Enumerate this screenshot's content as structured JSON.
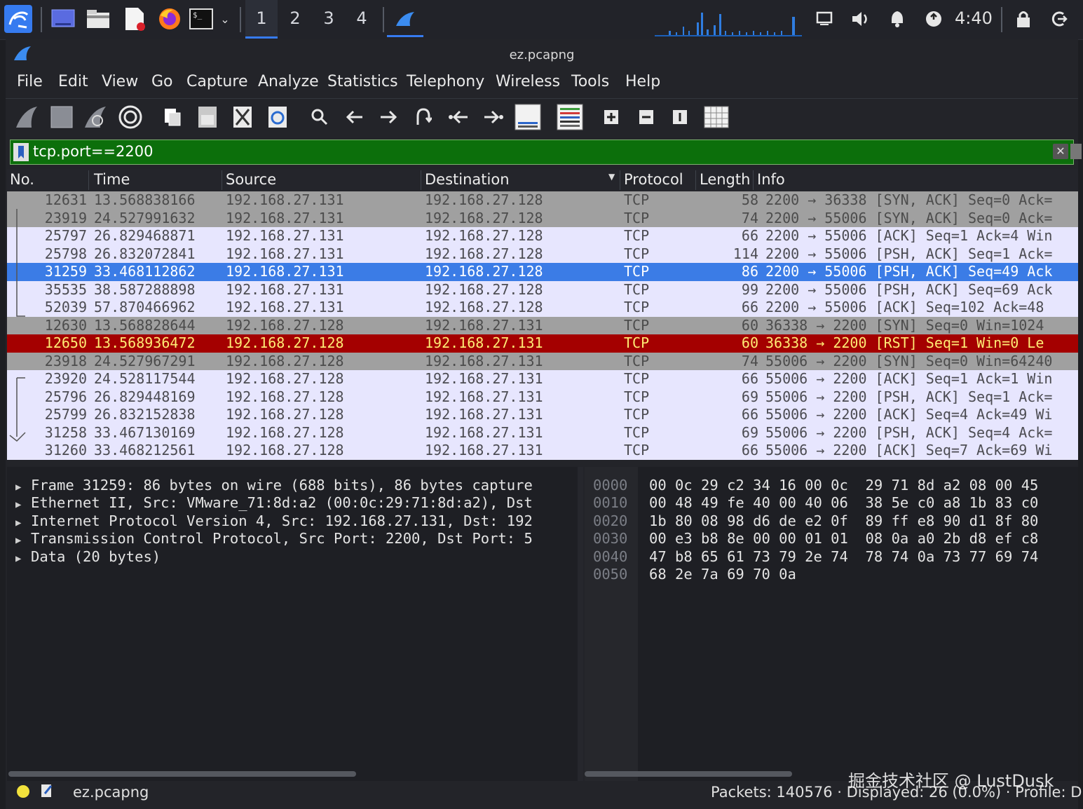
{
  "taskbar": {
    "workspaces": [
      "1",
      "2",
      "3",
      "4"
    ],
    "active_workspace": "1",
    "clock": "4:40",
    "icons": [
      "kali-menu-icon",
      "desktop-icon",
      "file-manager-icon",
      "text-editor-icon",
      "firefox-icon",
      "terminal-icon",
      "chevron-down-icon",
      "wireshark-taskbar-icon",
      "network-graph",
      "screen-icon",
      "volume-icon",
      "bell-icon",
      "power-icon",
      "lock-icon",
      "logout-icon"
    ]
  },
  "window": {
    "title": "ez.pcapng"
  },
  "menu": [
    "File",
    "Edit",
    "View",
    "Go",
    "Capture",
    "Analyze",
    "Statistics",
    "Telephony",
    "Wireless",
    "Tools",
    "Help"
  ],
  "toolbar": [
    "start-capture-icon",
    "stop-capture-icon",
    "restart-capture-icon",
    "capture-options-icon",
    "open-icon",
    "save-icon",
    "close-file-icon",
    "reload-icon",
    "find-icon",
    "back-icon",
    "forward-icon",
    "goto-packet-icon",
    "first-packet-icon",
    "last-packet-icon",
    "autoscroll-icon",
    "colorize-icon",
    "zoom-in-icon",
    "zoom-out-icon",
    "normal-size-icon",
    "resize-columns-icon"
  ],
  "filter": {
    "value": "tcp.port==2200"
  },
  "columns": [
    "No.",
    "Time",
    "Source",
    "Destination",
    "Protocol",
    "Length",
    "Info"
  ],
  "packets": [
    {
      "no": "12631",
      "time": "13.568838166",
      "src": "192.168.27.131",
      "dst": "192.168.27.128",
      "proto": "TCP",
      "len": "58",
      "info": "2200 → 36338 [SYN, ACK] Seq=0 Ack=",
      "style": "gray"
    },
    {
      "no": "23919",
      "time": "24.527991632",
      "src": "192.168.27.131",
      "dst": "192.168.27.128",
      "proto": "TCP",
      "len": "74",
      "info": "2200 → 55006 [SYN, ACK] Seq=0 Ack=",
      "style": "gray"
    },
    {
      "no": "25797",
      "time": "26.829468871",
      "src": "192.168.27.131",
      "dst": "192.168.27.128",
      "proto": "TCP",
      "len": "66",
      "info": "2200 → 55006 [ACK] Seq=1 Ack=4 Win",
      "style": "light"
    },
    {
      "no": "25798",
      "time": "26.832072841",
      "src": "192.168.27.131",
      "dst": "192.168.27.128",
      "proto": "TCP",
      "len": "114",
      "info": "2200 → 55006 [PSH, ACK] Seq=1 Ack=",
      "style": "light"
    },
    {
      "no": "31259",
      "time": "33.468112862",
      "src": "192.168.27.131",
      "dst": "192.168.27.128",
      "proto": "TCP",
      "len": "86",
      "info": "2200 → 55006 [PSH, ACK] Seq=49 Ack",
      "style": "sel"
    },
    {
      "no": "35535",
      "time": "38.587288898",
      "src": "192.168.27.131",
      "dst": "192.168.27.128",
      "proto": "TCP",
      "len": "99",
      "info": "2200 → 55006 [PSH, ACK] Seq=69 Ack",
      "style": "light"
    },
    {
      "no": "52039",
      "time": "57.870466962",
      "src": "192.168.27.131",
      "dst": "192.168.27.128",
      "proto": "TCP",
      "len": "66",
      "info": "2200 → 55006 [ACK] Seq=102 Ack=48",
      "style": "light"
    },
    {
      "no": "12630",
      "time": "13.568828644",
      "src": "192.168.27.128",
      "dst": "192.168.27.131",
      "proto": "TCP",
      "len": "60",
      "info": "36338 → 2200 [SYN] Seq=0 Win=1024",
      "style": "gray"
    },
    {
      "no": "12650",
      "time": "13.568936472",
      "src": "192.168.27.128",
      "dst": "192.168.27.131",
      "proto": "TCP",
      "len": "60",
      "info": "36338 → 2200 [RST] Seq=1 Win=0 Le",
      "style": "red"
    },
    {
      "no": "23918",
      "time": "24.527967291",
      "src": "192.168.27.128",
      "dst": "192.168.27.131",
      "proto": "TCP",
      "len": "74",
      "info": "55006 → 2200 [SYN] Seq=0 Win=64240",
      "style": "gray"
    },
    {
      "no": "23920",
      "time": "24.528117544",
      "src": "192.168.27.128",
      "dst": "192.168.27.131",
      "proto": "TCP",
      "len": "66",
      "info": "55006 → 2200 [ACK] Seq=1 Ack=1 Win",
      "style": "light"
    },
    {
      "no": "25796",
      "time": "26.829448169",
      "src": "192.168.27.128",
      "dst": "192.168.27.131",
      "proto": "TCP",
      "len": "69",
      "info": "55006 → 2200 [PSH, ACK] Seq=1 Ack=",
      "style": "light"
    },
    {
      "no": "25799",
      "time": "26.832152838",
      "src": "192.168.27.128",
      "dst": "192.168.27.131",
      "proto": "TCP",
      "len": "66",
      "info": "55006 → 2200 [ACK] Seq=4 Ack=49 Wi",
      "style": "light"
    },
    {
      "no": "31258",
      "time": "33.467130169",
      "src": "192.168.27.128",
      "dst": "192.168.27.131",
      "proto": "TCP",
      "len": "69",
      "info": "55006 → 2200 [PSH, ACK] Seq=4 Ack=",
      "style": "light"
    },
    {
      "no": "31260",
      "time": "33.468212561",
      "src": "192.168.27.128",
      "dst": "192.168.27.131",
      "proto": "TCP",
      "len": "66",
      "info": "55006 → 2200 [ACK] Seq=7 Ack=69 Wi",
      "style": "light"
    }
  ],
  "details": [
    "Frame 31259: 86 bytes on wire (688 bits), 86 bytes capture",
    "Ethernet II, Src: VMware_71:8d:a2 (00:0c:29:71:8d:a2), Dst",
    "Internet Protocol Version 4, Src: 192.168.27.131, Dst: 192",
    "Transmission Control Protocol, Src Port: 2200, Dst Port: 5",
    "Data (20 bytes)"
  ],
  "bytes": [
    {
      "offset": "0000",
      "hex": "00 0c 29 c2 34 16 00 0c  29 71 8d a2 08 00 45"
    },
    {
      "offset": "0010",
      "hex": "00 48 49 fe 40 00 40 06  38 5e c0 a8 1b 83 c0"
    },
    {
      "offset": "0020",
      "hex": "1b 80 08 98 d6 de e2 0f  89 ff e8 90 d1 8f 80"
    },
    {
      "offset": "0030",
      "hex": "00 e3 b8 8e 00 00 01 01  08 0a a0 2b d8 ef c8"
    },
    {
      "offset": "0040",
      "hex": "47 b8 65 61 73 79 2e 74  78 74 0a 73 77 69 74"
    },
    {
      "offset": "0050",
      "hex": "68 2e 7a 69 70 0a"
    }
  ],
  "status": {
    "file": "ez.pcapng",
    "packets": "Packets: 140576 · Displayed: 26 (0.0%)",
    "profile": "Profile: D"
  },
  "watermark": "掘金技术社区 @ LustDusk",
  "colors": {
    "filter_bg": "#0c6f0b",
    "selected_row": "#3b7ce6",
    "rst_row": "#a40000",
    "rst_text": "#ffec75"
  }
}
